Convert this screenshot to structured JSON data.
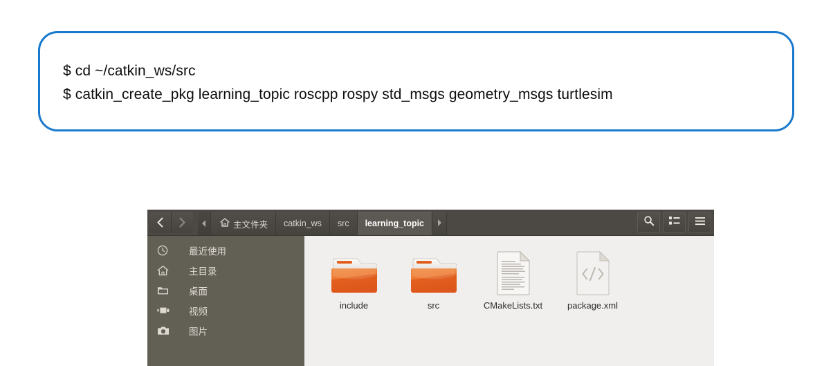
{
  "callout": {
    "border_color": "#1879cd",
    "lines": [
      "$ cd ~/catkin_ws/src",
      "$ catkin_create_pkg learning_topic roscpp rospy std_msgs geometry_msgs turtlesim"
    ]
  },
  "file_manager": {
    "theme": {
      "header_bg": "#4c4945",
      "sidebar_bg": "#625f55",
      "content_bg": "#f1efee",
      "active_crumb_bg": "#5c5853",
      "folder_color": "#e8642a"
    },
    "nav_buttons": [
      {
        "name": "back-button",
        "icon": "chevron-left-icon"
      },
      {
        "name": "forward-button",
        "icon": "chevron-right-icon"
      }
    ],
    "breadcrumb": {
      "overflow_icon": "chevron-left-small-icon",
      "home_icon": "home-icon",
      "items": [
        {
          "label": "主文件夹",
          "active": false,
          "has_home_icon": true
        },
        {
          "label": "catkin_ws",
          "active": false,
          "has_home_icon": false
        },
        {
          "label": "src",
          "active": false,
          "has_home_icon": false
        },
        {
          "label": "learning_topic",
          "active": true,
          "has_home_icon": false
        }
      ],
      "next_icon": "chevron-right-small-icon"
    },
    "toolbar_buttons": [
      {
        "name": "search-button",
        "icon": "search-icon"
      },
      {
        "name": "view-list-button",
        "icon": "list-view-icon"
      },
      {
        "name": "menu-button",
        "icon": "hamburger-menu-icon"
      }
    ],
    "sidebar": {
      "items": [
        {
          "label": "最近使用",
          "icon": "clock-icon"
        },
        {
          "label": "主目录",
          "icon": "home-icon"
        },
        {
          "label": "桌面",
          "icon": "folder-icon"
        },
        {
          "label": "视频",
          "icon": "video-camera-icon"
        },
        {
          "label": "图片",
          "icon": "camera-icon"
        }
      ]
    },
    "files": [
      {
        "name": "include",
        "type": "folder"
      },
      {
        "name": "src",
        "type": "folder"
      },
      {
        "name": "CMakeLists.txt",
        "type": "text-document"
      },
      {
        "name": "package.xml",
        "type": "xml-document"
      }
    ]
  }
}
